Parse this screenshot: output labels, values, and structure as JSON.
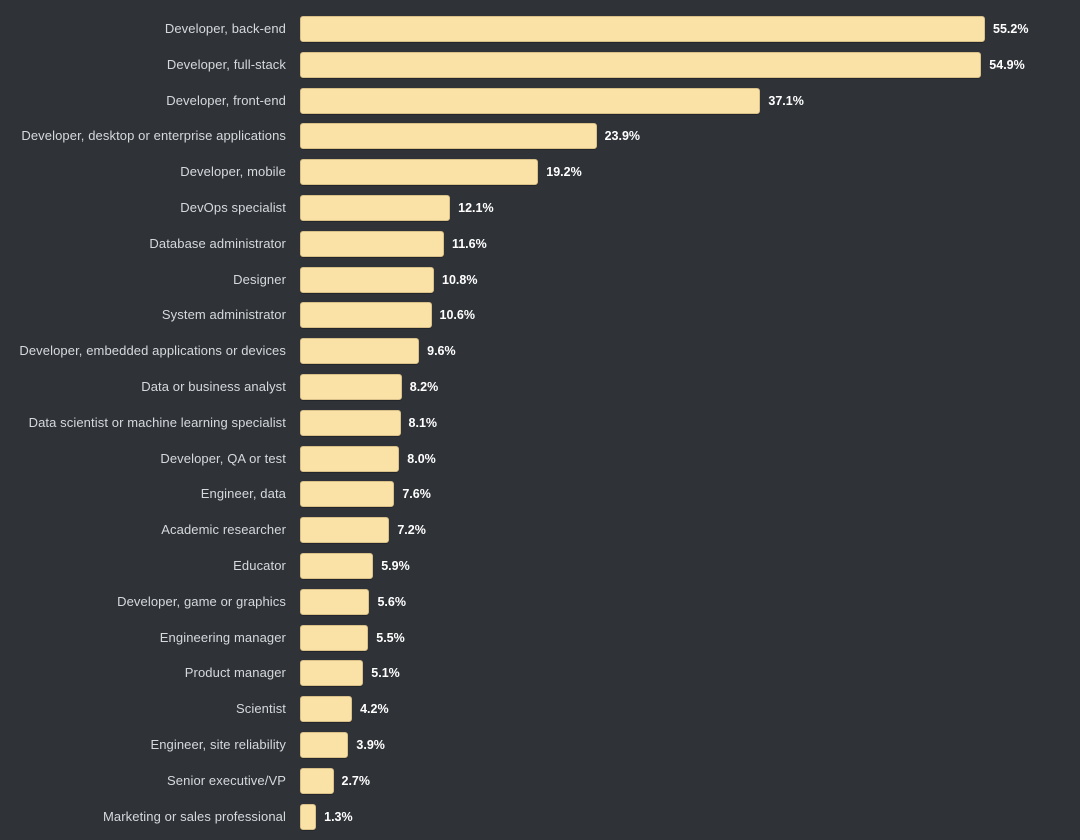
{
  "chart_data": {
    "type": "bar",
    "orientation": "horizontal",
    "title": "",
    "subtitle": "",
    "xlabel": "",
    "ylabel": "",
    "grid": false,
    "legend": null,
    "xlim": [
      0,
      55.2
    ],
    "value_suffix": "%",
    "categories": [
      "Developer, back-end",
      "Developer, full-stack",
      "Developer, front-end",
      "Developer, desktop or enterprise applications",
      "Developer, mobile",
      "DevOps specialist",
      "Database administrator",
      "Designer",
      "System administrator",
      "Developer, embedded applications or devices",
      "Data or business analyst",
      "Data scientist or machine learning specialist",
      "Developer, QA or test",
      "Engineer, data",
      "Academic researcher",
      "Educator",
      "Developer, game or graphics",
      "Engineering manager",
      "Product manager",
      "Scientist",
      "Engineer, site reliability",
      "Senior executive/VP",
      "Marketing or sales professional"
    ],
    "values": [
      55.2,
      54.9,
      37.1,
      23.9,
      19.2,
      12.1,
      11.6,
      10.8,
      10.6,
      9.6,
      8.2,
      8.1,
      8.0,
      7.6,
      7.2,
      5.9,
      5.6,
      5.5,
      5.1,
      4.2,
      3.9,
      2.7,
      1.3
    ],
    "value_labels": [
      "55.2%",
      "54.9%",
      "37.1%",
      "23.9%",
      "19.2%",
      "12.1%",
      "11.6%",
      "10.8%",
      "10.6%",
      "9.6%",
      "8.2%",
      "8.1%",
      "8.0%",
      "7.6%",
      "7.2%",
      "5.9%",
      "5.6%",
      "5.5%",
      "5.1%",
      "4.2%",
      "3.9%",
      "2.7%",
      "1.3%"
    ]
  },
  "style": {
    "background": "#2f3338",
    "bar_fill": "#fae2a7",
    "bar_border": "#d9c089",
    "label_color": "#d6d9dc",
    "value_color": "#ffffff"
  }
}
